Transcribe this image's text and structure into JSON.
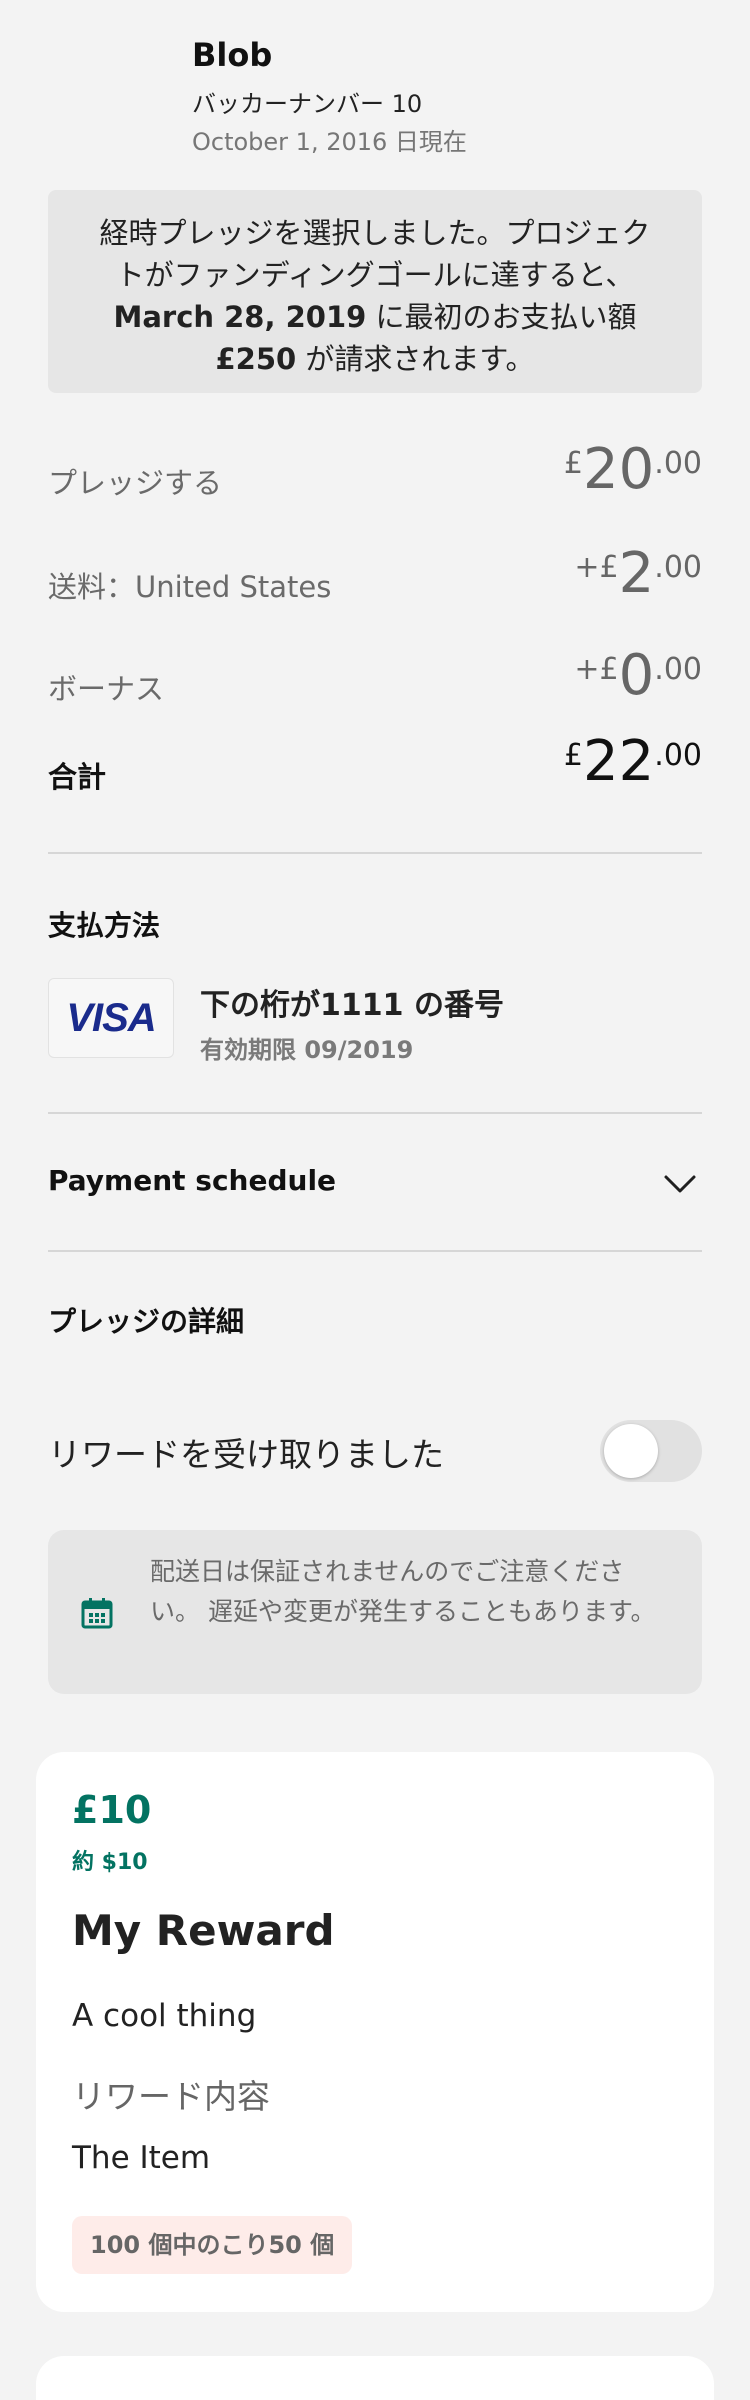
{
  "header": {
    "backer_name": "Blob",
    "backer_number": "バッカーナンバー 10",
    "as_of_date": "October 1, 2016 日現在"
  },
  "notice": {
    "line_start": "経時プレッジを選択しました。プロジェクトがファンディングゴールに達すると、",
    "date": "March 28, 2019",
    "middle": " に最初のお支払い額 ",
    "amount": "£250",
    "end": " が請求されます。"
  },
  "summary": {
    "pledge": {
      "label": "プレッジする",
      "prefix": "£",
      "whole": "20",
      "cents": ".00"
    },
    "shipping": {
      "label": "送料：United States",
      "prefix": "+£",
      "whole": "2",
      "cents": ".00"
    },
    "bonus": {
      "label": "ボーナス",
      "prefix": "+£",
      "whole": "0",
      "cents": ".00"
    },
    "total": {
      "label": "合計",
      "prefix": "£",
      "whole": "22",
      "cents": ".00"
    }
  },
  "payment_method": {
    "title": "支払方法",
    "card_brand": "VISA",
    "card_number": "下の桁が1111 の番号",
    "expiry": "有効期限 09/2019"
  },
  "payment_schedule": {
    "label": "Payment schedule",
    "icon": "chevron-down-icon"
  },
  "pledge_details": {
    "title": "プレッジの詳細",
    "reward_received_label": "リワードを受け取りました",
    "reward_received_on": false
  },
  "shipping_notice": {
    "icon": "calendar-icon",
    "text": "配送日は保証されませんのでご注意ください。 遅延や変更が発生することもあります。"
  },
  "reward": {
    "price": "£10",
    "approx": "約 $10",
    "title": "My Reward",
    "description": "A cool thing",
    "contents_label": "リワード内容",
    "item": "The Item",
    "remaining": "100 個中のこり50 個"
  },
  "colors": {
    "background": "#f3f3f3",
    "accent_green": "#037362",
    "badge_bg": "#feece9",
    "visa_blue": "#1a2b8c"
  }
}
